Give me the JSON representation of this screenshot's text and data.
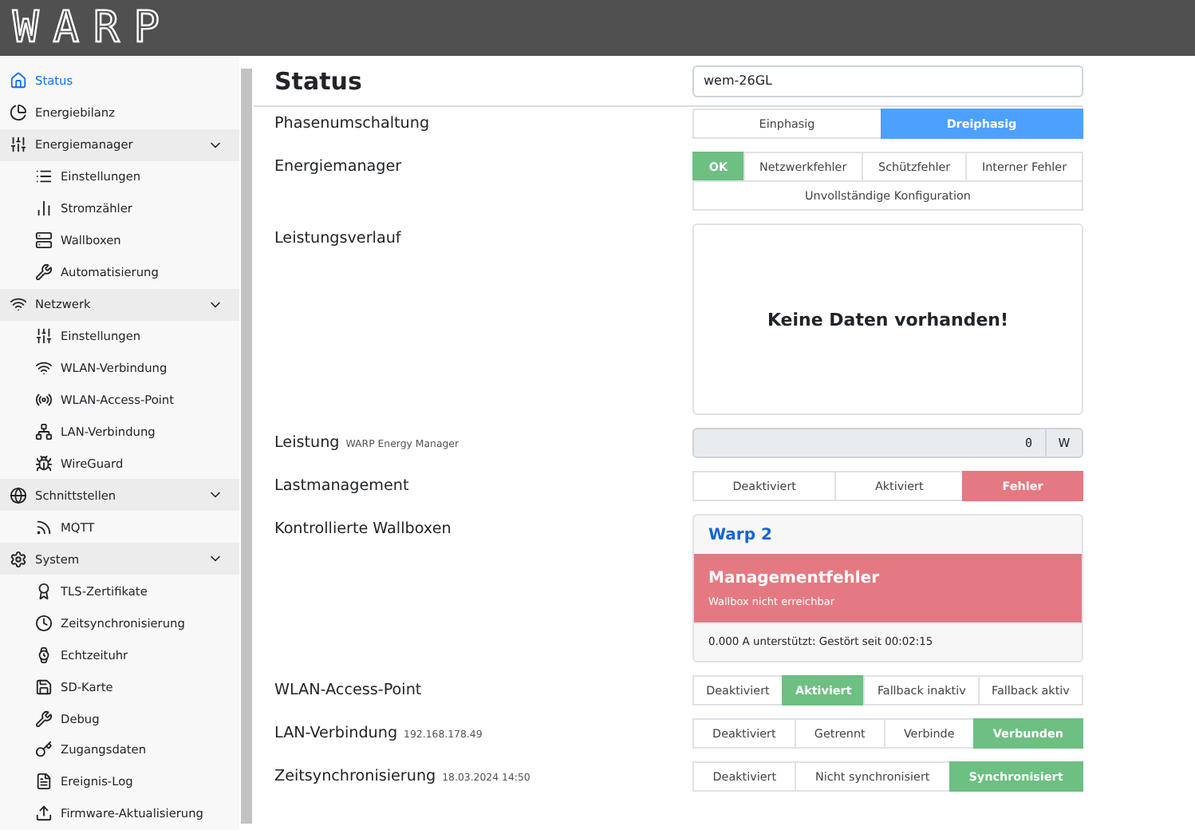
{
  "header": {
    "logo": "WARP"
  },
  "sidebar": {
    "items": [
      {
        "label": "Status",
        "selected": true
      },
      {
        "label": "Energiebilanz",
        "selected": false
      },
      {
        "label": "Energiemanager",
        "selected": false,
        "expanded": true,
        "children": [
          {
            "label": "Einstellungen",
            "selected": false
          },
          {
            "label": "Stromzähler",
            "selected": false
          },
          {
            "label": "Wallboxen",
            "selected": false
          },
          {
            "label": "Automatisierung",
            "selected": false
          }
        ]
      },
      {
        "label": "Netzwerk",
        "selected": false,
        "expanded": true,
        "children": [
          {
            "label": "Einstellungen",
            "selected": false
          },
          {
            "label": "WLAN-Verbindung",
            "selected": false
          },
          {
            "label": "WLAN-Access-Point",
            "selected": false
          },
          {
            "label": "LAN-Verbindung",
            "selected": false
          },
          {
            "label": "WireGuard",
            "selected": false
          }
        ]
      },
      {
        "label": "Schnittstellen",
        "selected": false,
        "expanded": true,
        "children": [
          {
            "label": "MQTT",
            "selected": false
          }
        ]
      },
      {
        "label": "System",
        "selected": false,
        "expanded": true,
        "children": [
          {
            "label": "TLS-Zertifikate",
            "selected": false
          },
          {
            "label": "Zeitsynchronisierung",
            "selected": false
          },
          {
            "label": "Echtzeituhr",
            "selected": false
          },
          {
            "label": "SD-Karte",
            "selected": false
          },
          {
            "label": "Debug",
            "selected": false
          },
          {
            "label": "Zugangsdaten",
            "selected": false
          },
          {
            "label": "Ereignis-Log",
            "selected": false
          },
          {
            "label": "Firmware-Aktualisierung",
            "selected": false
          }
        ]
      }
    ]
  },
  "page": {
    "title": "Status",
    "device_name": "wem-26GL"
  },
  "rows": [
    {
      "kind": "buttons",
      "label": "Phasenumschaltung",
      "color": "#4ea0ff",
      "options": [
        [
          {
            "label": "Einphasig",
            "selected": false
          },
          {
            "label": "Dreiphasig",
            "selected": true
          }
        ]
      ]
    },
    {
      "kind": "buttons",
      "label": "Energiemanager",
      "color": "#6dbf82",
      "options": [
        [
          {
            "label": "OK",
            "selected": true
          },
          {
            "label": "Netzwerkfehler",
            "selected": false
          },
          {
            "label": "Schützfehler",
            "selected": false
          },
          {
            "label": "Interner Fehler",
            "selected": false
          }
        ],
        [
          {
            "label": "Unvollständige Konfiguration",
            "selected": false
          }
        ]
      ]
    },
    {
      "kind": "chart",
      "label": "Leistungsverlauf",
      "message": "Keine Daten vorhanden!"
    },
    {
      "kind": "reading",
      "label": "Leistung",
      "sublabel": "WARP Energy Manager",
      "value": "0",
      "unit": "W"
    },
    {
      "kind": "buttons",
      "label": "Lastmanagement",
      "color": "#e57981",
      "options": [
        [
          {
            "label": "Deaktiviert",
            "selected": false
          },
          {
            "label": "Aktiviert",
            "selected": false
          },
          {
            "label": "Fehler",
            "selected": true
          }
        ]
      ]
    },
    {
      "kind": "wallboxes",
      "label": "Kontrollierte Wallboxen",
      "cards": [
        {
          "title": "Warp 2",
          "alert_title": "Managementfehler",
          "alert_text": "Wallbox nicht erreichbar",
          "footer": "0.000 A unterstützt: Gestört seit 00:02:15"
        }
      ]
    },
    {
      "kind": "buttons",
      "label": "WLAN-Access-Point",
      "color": "#6dbf82",
      "options": [
        [
          {
            "label": "Deaktiviert",
            "selected": false
          },
          {
            "label": "Aktiviert",
            "selected": true
          },
          {
            "label": "Fallback inaktiv",
            "selected": false
          },
          {
            "label": "Fallback aktiv",
            "selected": false
          }
        ]
      ]
    },
    {
      "kind": "buttons",
      "label": "LAN-Verbindung",
      "sublabel": "192.168.178.49",
      "color": "#6dbf82",
      "options": [
        [
          {
            "label": "Deaktiviert",
            "selected": false
          },
          {
            "label": "Getrennt",
            "selected": false
          },
          {
            "label": "Verbinde",
            "selected": false
          },
          {
            "label": "Verbunden",
            "selected": true
          }
        ]
      ]
    },
    {
      "kind": "buttons",
      "label": "Zeitsynchronisierung",
      "sublabel": "18.03.2024 14:50",
      "color": "#6dbf82",
      "options": [
        [
          {
            "label": "Deaktiviert",
            "selected": false
          },
          {
            "label": "Nicht synchronisiert",
            "selected": false
          },
          {
            "label": "Synchronisiert",
            "selected": true
          }
        ]
      ]
    }
  ]
}
